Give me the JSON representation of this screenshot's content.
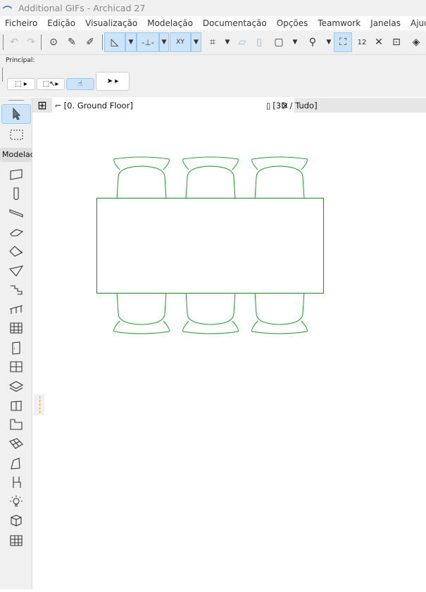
{
  "window": {
    "title": "Additional GIFs - Archicad 27"
  },
  "menu": [
    "Ficheiro",
    "Edição",
    "Visualização",
    "Modelação",
    "Documentação",
    "Opções",
    "Teamwork",
    "Janelas",
    "Ajuda"
  ],
  "panel": {
    "label": "Principal:"
  },
  "tabs": [
    {
      "label": "[0. Ground Floor]",
      "close": "×"
    },
    {
      "label": "[3D / Tudo]"
    }
  ],
  "toolbox": {
    "section": "Modelac",
    "tools": [
      "arrow",
      "marquee",
      "wall",
      "column",
      "beam",
      "slab",
      "roof",
      "shell",
      "stair",
      "railing",
      "curtain-wall",
      "door",
      "window",
      "skylight",
      "object",
      "zone",
      "mesh",
      "morph",
      "chair-object",
      "lamp",
      "stack",
      "grid"
    ]
  },
  "drawing": {
    "stroke": "#1a9b2e",
    "chairs_per_side": 3
  }
}
